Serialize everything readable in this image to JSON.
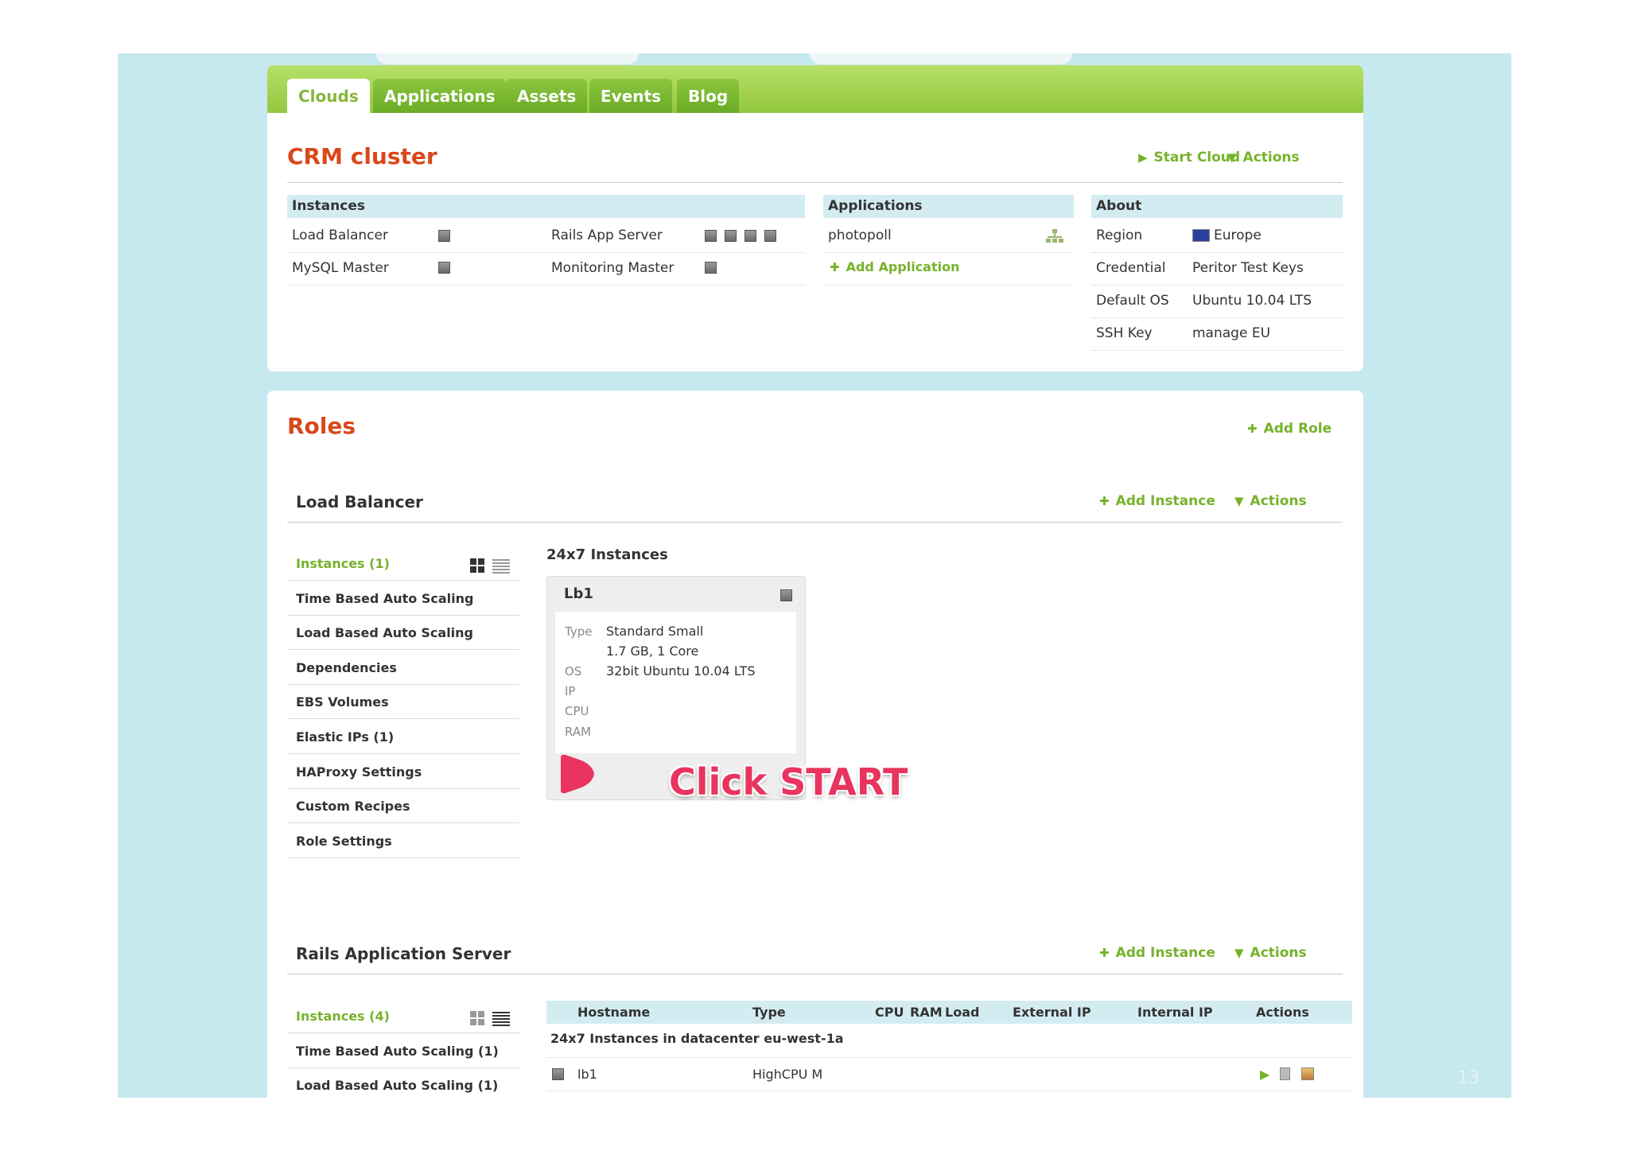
{
  "tabs": [
    "Clouds",
    "Applications",
    "Assets",
    "Events",
    "Blog"
  ],
  "cloud": {
    "title": "CRM cluster",
    "start_cloud": "Start Cloud",
    "actions": "Actions",
    "instances_header": "Instances",
    "instances": [
      {
        "name": "Load Balancer",
        "count": 1
      },
      {
        "name": "Rails App Server",
        "count": 4
      },
      {
        "name": "MySQL Master",
        "count": 1
      },
      {
        "name": "Monitoring Master",
        "count": 1
      }
    ],
    "applications_header": "Applications",
    "applications": [
      "photopoll"
    ],
    "add_application": "Add Application",
    "about_header": "About",
    "about": [
      {
        "label": "Region",
        "value": "Europe"
      },
      {
        "label": "Credential",
        "value": "Peritor Test Keys"
      },
      {
        "label": "Default OS",
        "value": "Ubuntu 10.04 LTS"
      },
      {
        "label": "SSH Key",
        "value": "manage EU"
      }
    ]
  },
  "roles": {
    "title": "Roles",
    "add_role": "Add Role",
    "load_balancer": {
      "title": "Load Balancer",
      "add_instance": "Add Instance",
      "actions": "Actions",
      "menu": [
        "Instances (1)",
        "Time Based Auto Scaling",
        "Load Based Auto Scaling",
        "Dependencies",
        "EBS Volumes",
        "Elastic IPs (1)",
        "HAProxy Settings",
        "Custom Recipes",
        "Role Settings"
      ],
      "instances_title": "24x7 Instances",
      "card": {
        "name": "Lb1",
        "type_label": "Type",
        "type_value": "Standard Small",
        "type_value2": "1.7 GB, 1 Core",
        "os_label": "OS",
        "os_value": "32bit Ubuntu 10.04 LTS",
        "ip_label": "IP",
        "cpu_label": "CPU",
        "ram_label": "RAM"
      },
      "callout": "Click START"
    },
    "rails": {
      "title": "Rails Application Server",
      "add_instance": "Add Instance",
      "actions": "Actions",
      "menu": [
        "Instances (4)",
        "Time Based Auto Scaling (1)",
        "Load Based Auto Scaling (1)"
      ],
      "columns": [
        "Hostname",
        "Type",
        "CPU",
        "RAM",
        "Load",
        "External IP",
        "Internal IP",
        "Actions"
      ],
      "group_label": "24x7 Instances in datacenter eu-west-1a",
      "rows": [
        {
          "hostname": "lb1",
          "type": "HighCPU M"
        }
      ]
    }
  },
  "page_number": "13",
  "colors": {
    "accent_green": "#76b22b",
    "title_red": "#d9481c",
    "header_blue": "#d3ecf2",
    "slide_bg": "#c6e8ef",
    "callout_pink": "#e8345f"
  }
}
